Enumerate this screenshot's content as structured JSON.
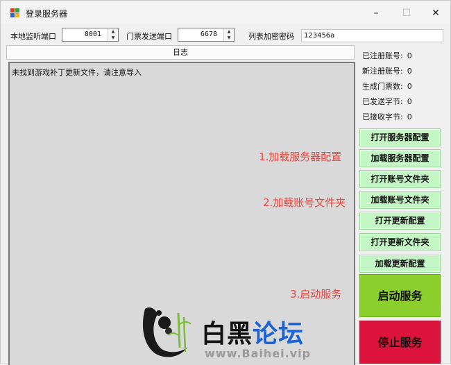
{
  "window": {
    "title": "登录服务器",
    "minimize": "–",
    "maximize": "☐",
    "close": "✕"
  },
  "top": {
    "listen_port_label": "本地监听端口",
    "listen_port_value": "8001",
    "ticket_port_label": "门票发送端口",
    "ticket_port_value": "6678",
    "password_label": "列表加密密码",
    "password_value": "123456a"
  },
  "log": {
    "header": "日志",
    "lines": [
      "未找到游戏补丁更新文件，请注意导入"
    ]
  },
  "stats": [
    {
      "label": "已注册账号:",
      "value": "0"
    },
    {
      "label": "新注册账号:",
      "value": "0"
    },
    {
      "label": "生成门票数:",
      "value": "0"
    },
    {
      "label": "已发送字节:",
      "value": "0"
    },
    {
      "label": "已接收字节:",
      "value": "0"
    }
  ],
  "buttons": [
    "打开服务器配置",
    "加载服务器配置",
    "打开账号文件夹",
    "加载账号文件夹",
    "打开更新配置",
    "打开更新文件夹",
    "加载更新配置"
  ],
  "start_button": "启动服务",
  "stop_button": "停止服务",
  "annotations": [
    "1.加载服务器配置",
    "2.加载账号文件夹",
    "3.启动服务"
  ],
  "watermark": {
    "text_black": "白黑",
    "text_blue": "论坛",
    "url": "www.Baihei.vip"
  },
  "colors": {
    "green_button": "#c4f5c4",
    "start": "#8ccf2d",
    "stop": "#dc143c",
    "annotation": "#e8453c",
    "watermark_blue": "#1e63d6"
  }
}
